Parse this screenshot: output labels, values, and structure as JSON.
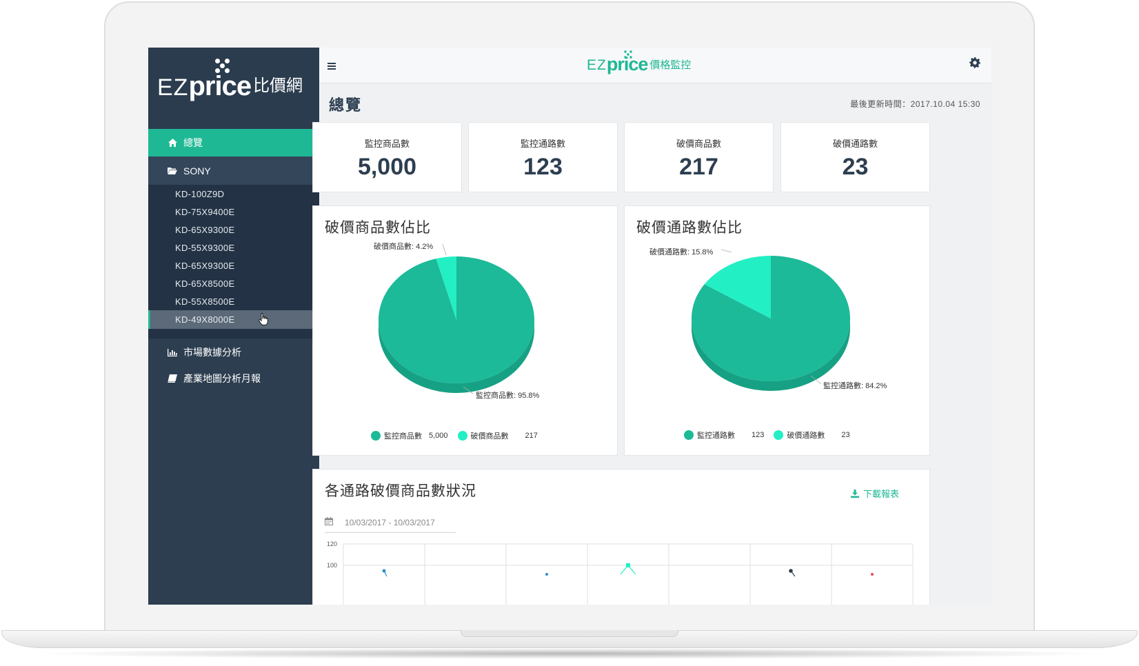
{
  "sidebar": {
    "logo": {
      "ez": "EZ",
      "price": "price",
      "cn": "比價網"
    },
    "nav": [
      {
        "label": "總覽",
        "icon": "home-icon"
      },
      {
        "label": "SONY",
        "icon": "folder-open-icon"
      },
      {
        "label": "市場數據分析",
        "icon": "bar-chart-icon"
      },
      {
        "label": "產業地圖分析月報",
        "icon": "book-icon"
      }
    ],
    "sony_items": [
      "KD-100Z9D",
      "KD-75X9400E",
      "KD-65X9300E",
      "KD-55X9300E",
      "KD-65X9300E",
      "KD-65X8500E",
      "KD-55X8500E",
      "KD-49X8000E"
    ],
    "selected_item": "KD-49X8000E"
  },
  "topbar": {
    "brand_ez": "EZ",
    "brand_price": "price",
    "brand_cn": "價格監控",
    "menu_icon": "hamburger-icon",
    "settings_icon": "gear-icon"
  },
  "page": {
    "title": "總覽",
    "updated": "最後更新時間：2017.10.04   15:30"
  },
  "stats": [
    {
      "label": "監控商品數",
      "value": "5,000"
    },
    {
      "label": "監控通路數",
      "value": "123"
    },
    {
      "label": "破價商品數",
      "value": "217"
    },
    {
      "label": "破價通路數",
      "value": "23"
    }
  ],
  "colors": {
    "accent": "#1fb895",
    "accent_light": "#23efc5",
    "sidebar": "#2d3e50"
  },
  "chart_data": [
    {
      "type": "pie",
      "title": "破價商品數佔比",
      "slices": [
        {
          "name": "監控商品數",
          "label": "監控商品數: 95.8%",
          "percent": 95.8,
          "value": 5000,
          "value_text": "5,000",
          "color": "#1cba98"
        },
        {
          "name": "破價商品數",
          "label": "破價商品數: 4.2%",
          "percent": 4.2,
          "value": 217,
          "value_text": "217",
          "color": "#23efc5"
        }
      ]
    },
    {
      "type": "pie",
      "title": "破價通路數佔比",
      "slices": [
        {
          "name": "監控通路數",
          "label": "監控通路數: 84.2%",
          "percent": 84.2,
          "value": 123,
          "value_text": "123",
          "color": "#1cba98"
        },
        {
          "name": "破價通路數",
          "label": "破價通路數: 15.8%",
          "percent": 15.8,
          "value": 23,
          "value_text": "23",
          "color": "#23efc5"
        }
      ]
    },
    {
      "type": "line",
      "title": "各通路破價商品數狀況",
      "y_ticks": [
        "120",
        "100"
      ],
      "ylim": [
        0,
        120
      ]
    }
  ],
  "line_panel": {
    "download_label": "下載報表",
    "date_range": "10/03/2017 - 10/03/2017"
  }
}
